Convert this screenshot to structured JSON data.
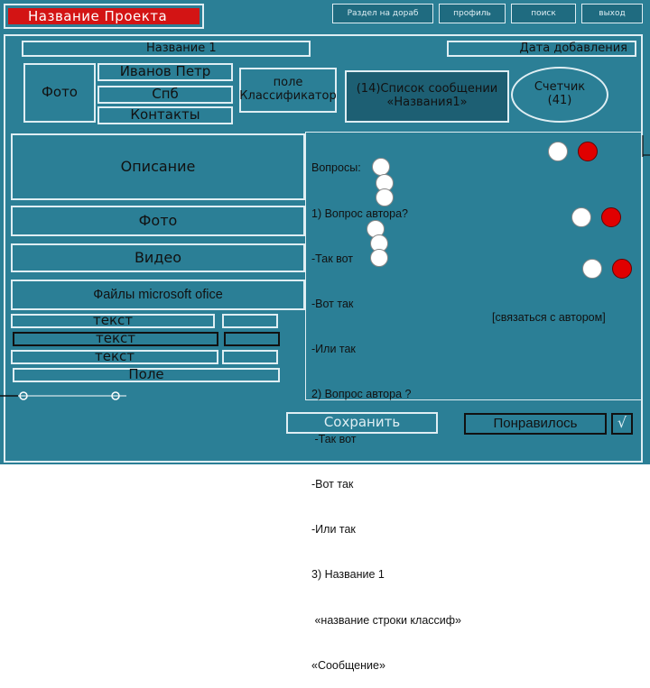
{
  "colors": {
    "frame": "#2b7f96",
    "border": "#dfeef3",
    "accent_red": "#d31414",
    "dot_red": "#e00000",
    "text": "#111111"
  },
  "header": {
    "project_title": "Название Проекта",
    "nav": [
      "Раздел на дораб",
      "профиль",
      "поиск",
      "выход"
    ]
  },
  "card": {
    "name_label": "Название 1",
    "date_label": "Дата добавления",
    "photo": "Фото",
    "author": {
      "name": "Иванов Петр",
      "city": "Спб",
      "contacts": "Контакты"
    },
    "classifier": "поле\nКлассификатор",
    "messages_title": "(14)Список сообщении\n«Названия1»",
    "counter": "Счетчик\n(41)",
    "description": "Описание",
    "photo2": "Фото",
    "video": "Видео",
    "files": "Файлы microsoft ofice",
    "text_rows": [
      "текст",
      "текст",
      "текст"
    ],
    "field": "Поле",
    "questions": [
      "Вопросы:",
      "1) Вопрос автора?",
      "-Так вот",
      "-Вот так",
      "-Или так",
      "2) Вопрос автора ?",
      " -Так вот",
      "-Вот так",
      "-Или так",
      "3) Название 1",
      " «название строки классиф»",
      "«Сообщение»"
    ],
    "contact_author": "[связаться с автором]",
    "save": "Сохранить",
    "like": "Понравилось",
    "checkbox_mark": "√"
  }
}
